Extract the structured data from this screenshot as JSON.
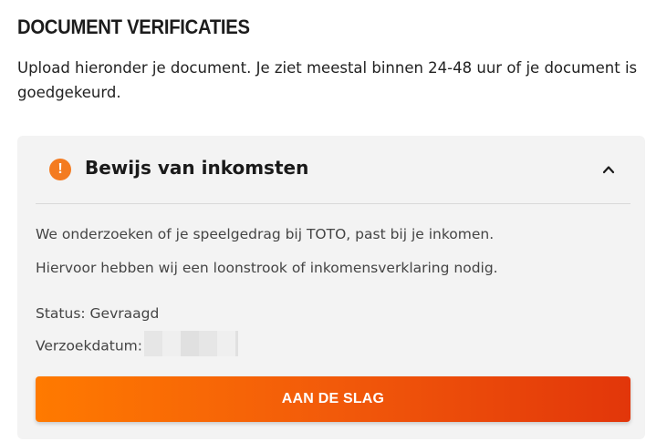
{
  "section": {
    "title": "DOCUMENT VERIFICATIES",
    "intro": "Upload hieronder je document. Je ziet meestal binnen 24-48 uur of je document is goedgekeurd."
  },
  "card": {
    "icon": "exclamation-icon",
    "icon_glyph": "!",
    "icon_color": "#f47b20",
    "title": "Bewijs van inkomsten",
    "expanded": true,
    "description_line1": "We onderzoeken of je speelgedrag bij TOTO, past bij je inkomen.",
    "description_line2": "Hiervoor hebben wij een loonstrook of inkomensverklaring nodig.",
    "status_label": "Status: Gevraagd",
    "date_label": "Verzoekdatum:",
    "cta_label": "AAN DE SLAG",
    "cta_colors": [
      "#ff7a00",
      "#e2360a"
    ]
  }
}
